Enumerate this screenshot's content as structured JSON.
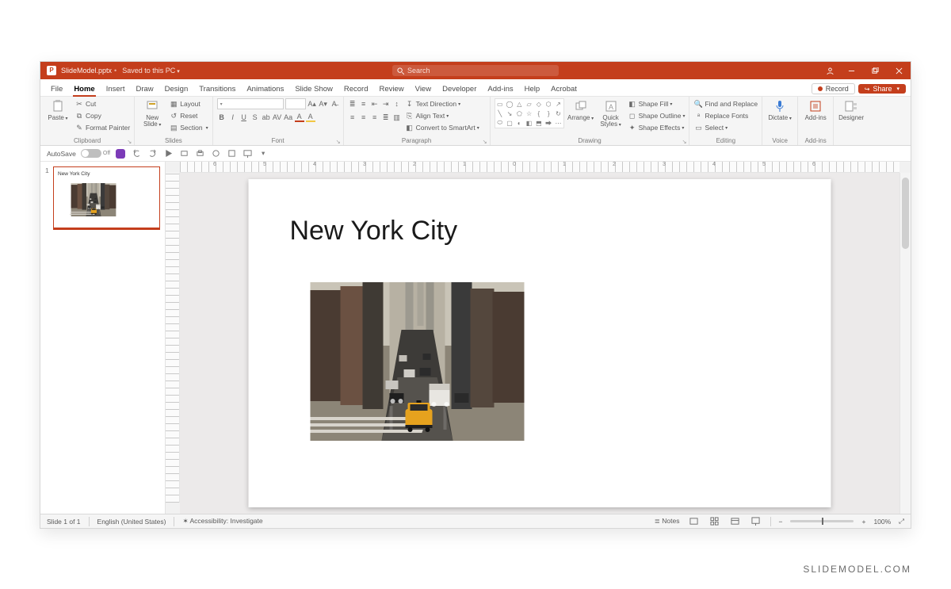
{
  "titlebar": {
    "document_name": "SlideModel.pptx",
    "save_state": "Saved to this PC",
    "search_placeholder": "Search"
  },
  "window_buttons": {
    "account": "",
    "minimize": "",
    "restore": "",
    "close": ""
  },
  "tabs": {
    "items": [
      "File",
      "Home",
      "Insert",
      "Draw",
      "Design",
      "Transitions",
      "Animations",
      "Slide Show",
      "Record",
      "Review",
      "View",
      "Developer",
      "Add-ins",
      "Help",
      "Acrobat"
    ],
    "active_index": 1,
    "record_button": "Record",
    "share_button": "Share"
  },
  "ribbon": {
    "clipboard": {
      "paste": "Paste",
      "cut": "Cut",
      "copy": "Copy",
      "format_painter": "Format Painter",
      "group_name": "Clipboard"
    },
    "slides": {
      "new_slide": "New\nSlide",
      "layout": "Layout",
      "reset": "Reset",
      "section": "Section",
      "group_name": "Slides"
    },
    "font": {
      "group_name": "Font",
      "buttons": [
        "B",
        "I",
        "U",
        "S",
        "ab",
        "AV",
        "Aa",
        "A",
        "A"
      ]
    },
    "paragraph": {
      "group_name": "Paragraph",
      "text_direction": "Text Direction",
      "align_text": "Align Text",
      "convert_smartart": "Convert to SmartArt"
    },
    "drawing": {
      "group_name": "Drawing",
      "arrange": "Arrange",
      "quick_styles": "Quick\nStyles",
      "shape_fill": "Shape Fill",
      "shape_outline": "Shape Outline",
      "shape_effects": "Shape Effects"
    },
    "editing": {
      "group_name": "Editing",
      "find_replace": "Find and Replace",
      "replace_fonts": "Replace Fonts",
      "select": "Select"
    },
    "voice": {
      "group_name": "Voice",
      "dictate": "Dictate"
    },
    "addins": {
      "group_name": "Add-ins",
      "label": "Add-ins"
    },
    "designer": {
      "group_name": "",
      "label": "Designer"
    }
  },
  "qat": {
    "autosave_label": "AutoSave",
    "autosave_state": "Off"
  },
  "ruler": {
    "numbers": [
      "6",
      "5",
      "4",
      "3",
      "2",
      "1",
      "0",
      "1",
      "2",
      "3",
      "4",
      "5",
      "6"
    ]
  },
  "thumbnails": {
    "items": [
      {
        "index": "1",
        "title": "New York City"
      }
    ]
  },
  "slide": {
    "title": "New York City"
  },
  "status": {
    "slide_counter": "Slide 1 of 1",
    "language": "English (United States)",
    "accessibility": "Accessibility: Investigate",
    "notes": "Notes",
    "zoom_pct": "100%"
  },
  "watermark": "SLIDEMODEL.COM"
}
